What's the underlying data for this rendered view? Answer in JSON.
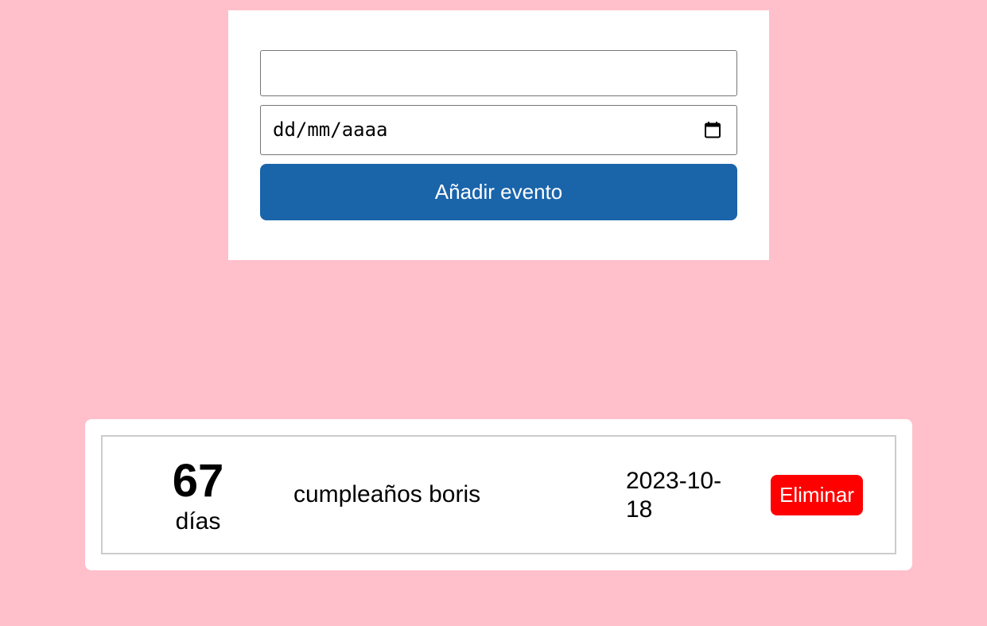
{
  "form": {
    "event_name_value": "",
    "date_placeholder": "dd/mm/aaaa",
    "add_button_label": "Añadir evento"
  },
  "colors": {
    "background": "#ffc0cb",
    "primary_button": "#1a64aa",
    "delete_button": "#ff0000"
  },
  "events": [
    {
      "days_remaining": "67",
      "days_label": "días",
      "name": "cumpleaños boris",
      "date": "2023-10-\n18",
      "delete_label": "Eliminar"
    }
  ]
}
